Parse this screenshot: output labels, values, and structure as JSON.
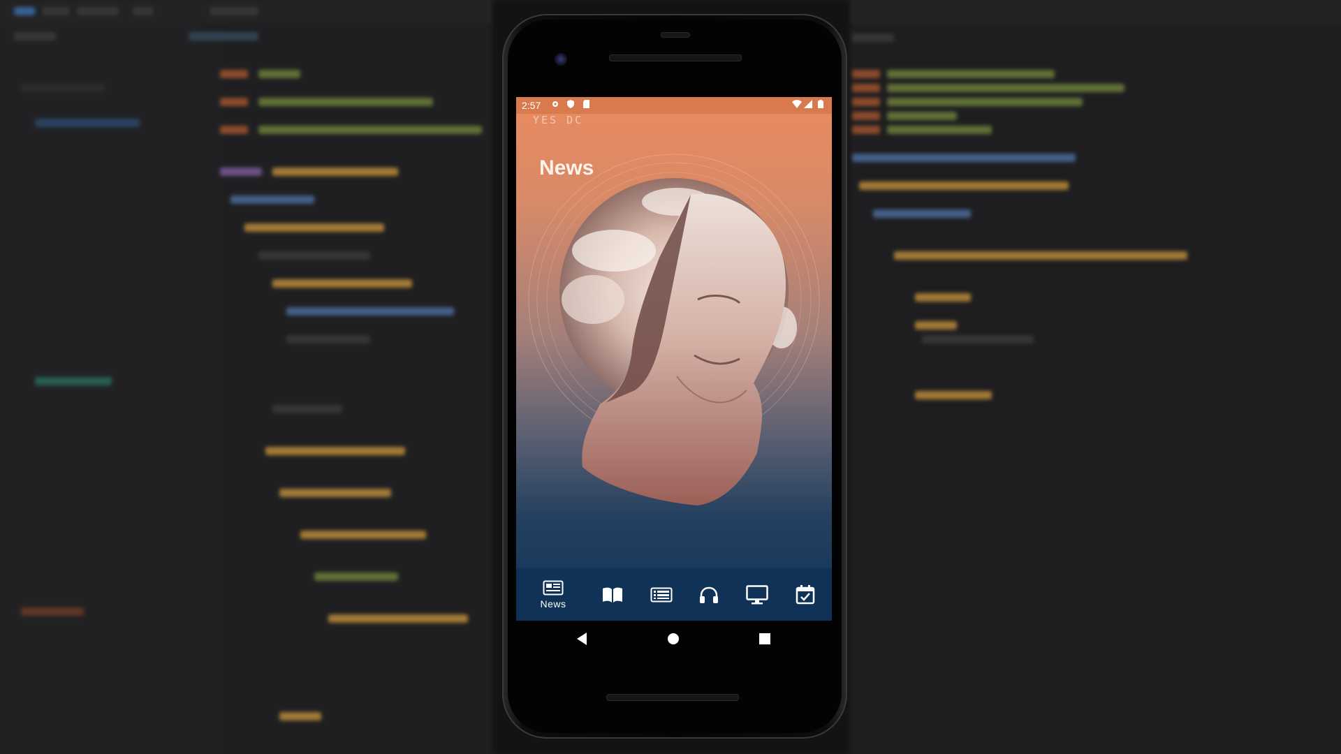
{
  "app": {
    "brand": "YES DC",
    "screen_title": "News"
  },
  "status_bar": {
    "time": "2:57",
    "left_icons": [
      "settings-icon",
      "shield-icon",
      "sd-card-icon"
    ],
    "right_icons": [
      "wifi-icon",
      "signal-icon",
      "battery-icon"
    ]
  },
  "bottom_nav": {
    "items": [
      {
        "label": "News",
        "icon": "newspaper-icon",
        "active": true
      },
      {
        "label": "",
        "icon": "book-icon",
        "active": false
      },
      {
        "label": "",
        "icon": "list-icon",
        "active": false
      },
      {
        "label": "",
        "icon": "headphones-icon",
        "active": false
      },
      {
        "label": "",
        "icon": "monitor-icon",
        "active": false
      },
      {
        "label": "",
        "icon": "calendar-check-icon",
        "active": false
      }
    ]
  },
  "system_nav": {
    "buttons": [
      "back-icon",
      "home-icon",
      "recents-icon"
    ]
  },
  "colors": {
    "gradient_top": "#e98a5f",
    "gradient_bottom": "#11335a",
    "status_bar": "#d8794e",
    "nav_bar": "#0f3256"
  }
}
